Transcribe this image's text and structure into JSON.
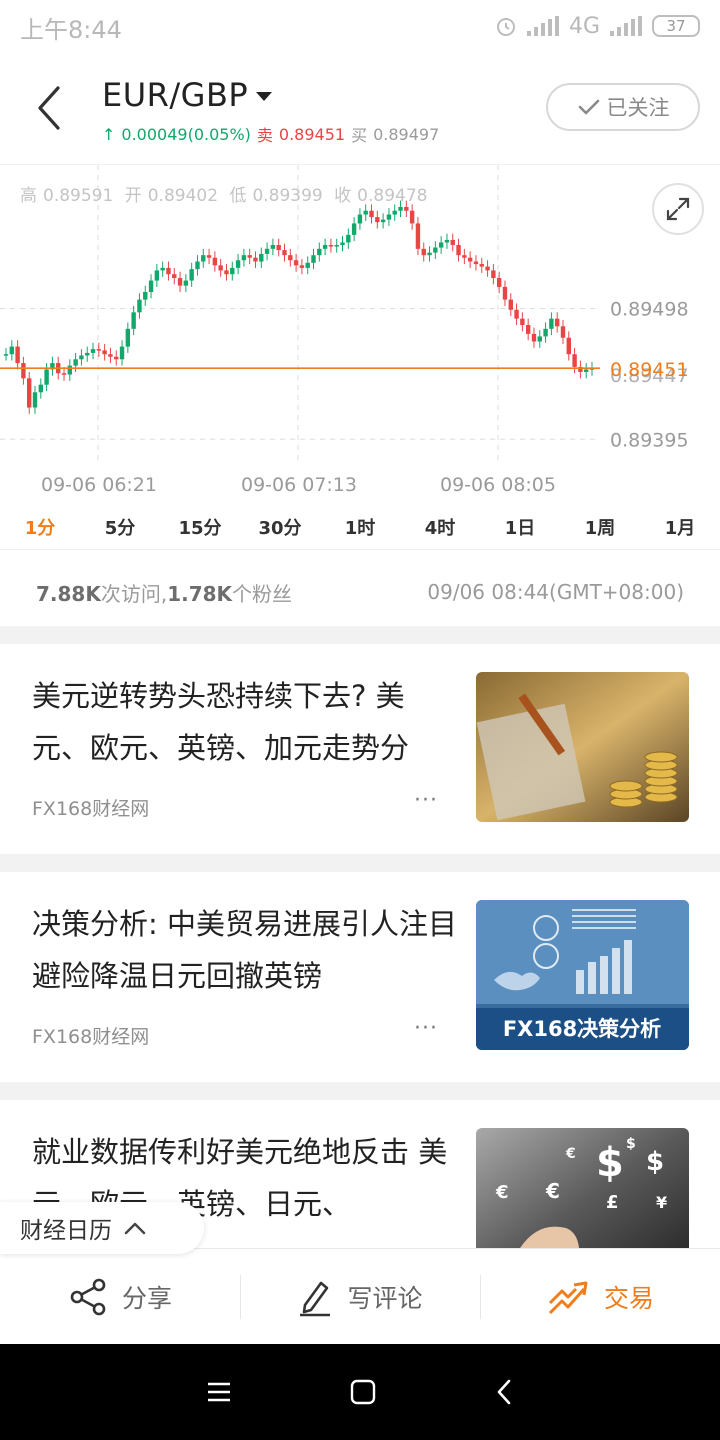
{
  "status_bar": {
    "time": "上午8:44",
    "network": "4G",
    "battery": "37"
  },
  "header": {
    "pair": "EUR/GBP",
    "change": "0.00049(0.05%)",
    "sell_label": "卖",
    "sell_price": "0.89451",
    "buy_label": "买",
    "buy_price": "0.89497",
    "follow_label": "已关注"
  },
  "ohlc": {
    "high_label": "高",
    "high": "0.89591",
    "open_label": "开",
    "open": "0.89402",
    "low_label": "低",
    "low": "0.89399",
    "close_label": "收",
    "close": "0.89478"
  },
  "chart_data": {
    "type": "candlestick",
    "x_ticks": [
      "09-06 06:21",
      "09-06 07:13",
      "09-06 08:05"
    ],
    "y_ticks": [
      "0.89498",
      "0.89395"
    ],
    "current_price_line": "0.89451",
    "overlapped_label": "0.89447",
    "ylim": [
      0.8937,
      0.896
    ],
    "grid": true,
    "series": [
      {
        "values": [
          0.89462,
          0.89468,
          0.89455,
          0.89443,
          0.8942,
          0.89432,
          0.89438,
          0.8945,
          0.89455,
          0.89447,
          0.89446,
          0.89453,
          0.89458,
          0.89461,
          0.89463,
          0.89466,
          0.89465,
          0.89462,
          0.8946,
          0.89458,
          0.89468,
          0.89482,
          0.89495,
          0.89505,
          0.89511,
          0.8952,
          0.89528,
          0.8953,
          0.89525,
          0.89522,
          0.89516,
          0.8952,
          0.89529,
          0.89535,
          0.8954,
          0.89538,
          0.89532,
          0.89528,
          0.89525,
          0.8953,
          0.89536,
          0.8954,
          0.89538,
          0.89535,
          0.89541,
          0.89545,
          0.89548,
          0.89544,
          0.8954,
          0.89536,
          0.89532,
          0.8953,
          0.89534,
          0.8954,
          0.89545,
          0.89548,
          0.89547,
          0.89548,
          0.8955,
          0.89556,
          0.89565,
          0.89572,
          0.89575,
          0.8957,
          0.89566,
          0.89568,
          0.89572,
          0.89575,
          0.89578,
          0.89575,
          0.89565,
          0.89545,
          0.8954,
          0.89542,
          0.89546,
          0.8955,
          0.89552,
          0.89548,
          0.8954,
          0.89538,
          0.89535,
          0.89533,
          0.89531,
          0.89528,
          0.89522,
          0.89515,
          0.89505,
          0.89497,
          0.8949,
          0.89485,
          0.89478,
          0.89472,
          0.89476,
          0.89482,
          0.8949,
          0.89484,
          0.89475,
          0.89462,
          0.89452,
          0.89448,
          0.8945,
          0.89451
        ]
      }
    ]
  },
  "intervals": [
    "1分",
    "5分",
    "15分",
    "30分",
    "1时",
    "4时",
    "1日",
    "1周",
    "1月"
  ],
  "stats": {
    "visits": "7.88K",
    "visits_label": "次访问,",
    "fans": "1.78K",
    "fans_label": "个粉丝",
    "datetime": "09/06 08:44(GMT+08:00)"
  },
  "news": [
    {
      "title": "美元逆转势头恐持续下去? 美元、欧元、英镑、加元走势分",
      "source": "FX168财经网",
      "more": "···"
    },
    {
      "title": "决策分析: 中美贸易进展引人注目 避险降温日元回撤英镑",
      "source": "FX168财经网",
      "more": "···",
      "thumb_text": "FX168决策分析"
    },
    {
      "title": "就业数据传利好美元绝地反击 美元、欧元、英镑、日元、",
      "source": "",
      "more": ""
    }
  ],
  "calendar_pill": {
    "label": "财经日历"
  },
  "actions": {
    "share": "分享",
    "comment": "写评论",
    "trade": "交易"
  },
  "colors": {
    "up": "#11a86b",
    "down": "#e84545",
    "accent": "#f07d1b"
  }
}
